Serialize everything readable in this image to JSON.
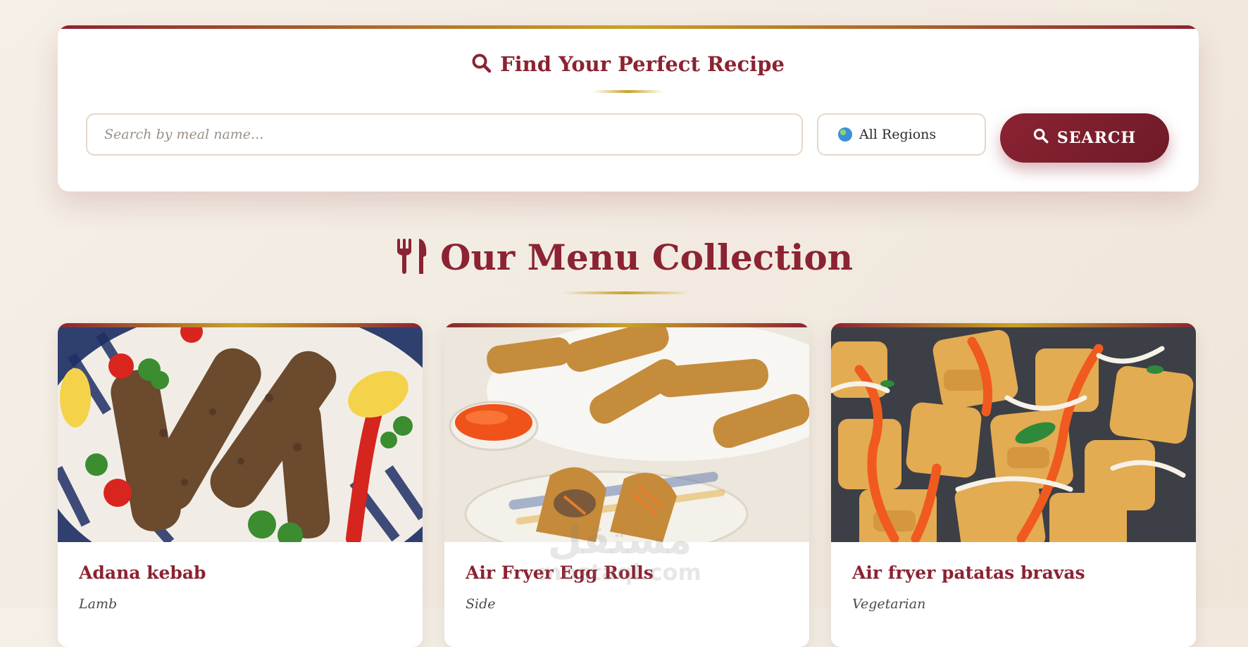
{
  "search": {
    "title": "Find Your Perfect Recipe",
    "placeholder": "Search by meal name...",
    "region_label": "All Regions",
    "button_label": "SEARCH"
  },
  "menu": {
    "title": "Our Menu Collection",
    "cards": [
      {
        "title": "Adana kebab",
        "category": "Lamb"
      },
      {
        "title": "Air Fryer Egg Rolls",
        "category": "Side"
      },
      {
        "title": "Air fryer patatas bravas",
        "category": "Vegetarian"
      }
    ]
  },
  "watermark": {
    "arabic": "مستقل",
    "latin": "mostaql.com"
  },
  "colors": {
    "accent": "#8b2332",
    "gold": "#c9a227",
    "background": "#f2ebe1"
  },
  "icons": [
    "search-icon",
    "globe-icon",
    "utensils-icon"
  ]
}
